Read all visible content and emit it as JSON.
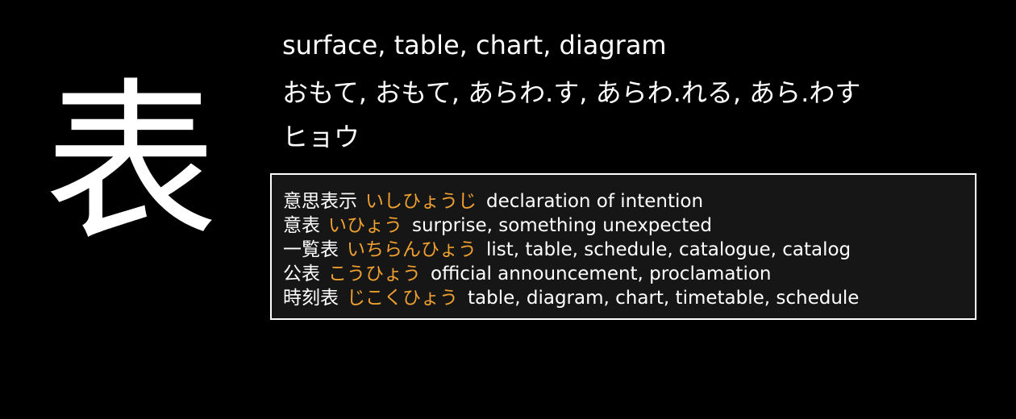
{
  "kanji": "表",
  "meaning": "surface, table, chart, diagram",
  "kun_readings": "おもて, おもて, あらわ.す, あらわ.れる, あら.わす",
  "on_readings": "ヒョウ",
  "colors": {
    "background": "#000000",
    "text": "#ffffff",
    "reading_accent": "#f0a030",
    "box_background": "#161616",
    "box_border": "#ffffff"
  },
  "vocab": [
    {
      "word": "意思表示",
      "reading": "いしひょうじ",
      "gloss": "declaration of intention"
    },
    {
      "word": "意表",
      "reading": "いひょう",
      "gloss": "surprise, something unexpected"
    },
    {
      "word": "一覧表",
      "reading": "いちらんひょう",
      "gloss": "list, table, schedule, catalogue, catalog"
    },
    {
      "word": "公表",
      "reading": "こうひょう",
      "gloss": "official announcement, proclamation"
    },
    {
      "word": "時刻表",
      "reading": "じこくひょう",
      "gloss": "table, diagram, chart, timetable, schedule"
    }
  ]
}
